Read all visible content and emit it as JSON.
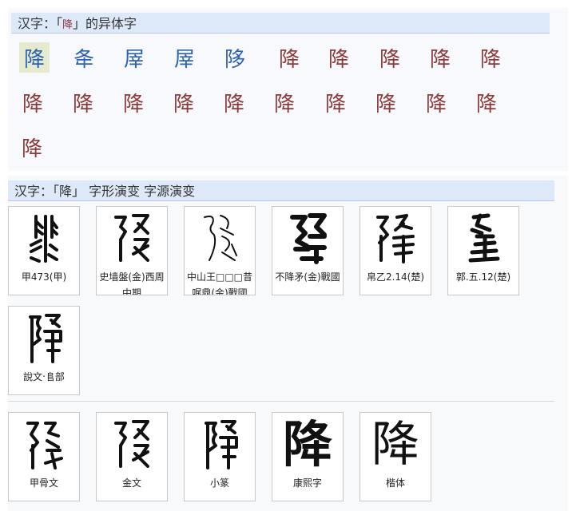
{
  "variants_header": {
    "prefix": "汉字：「",
    "char": "降",
    "suffix": "」的异体字"
  },
  "variant_glyphs": [
    {
      "text": "降",
      "style": "blue-selected"
    },
    {
      "text": "夅",
      "style": "blue"
    },
    {
      "text": "屖",
      "style": "blue"
    },
    {
      "text": "屖",
      "style": "blue"
    },
    {
      "text": "陊",
      "style": "blue"
    },
    {
      "text": "降",
      "style": "red"
    },
    {
      "text": "降",
      "style": "red"
    },
    {
      "text": "降",
      "style": "red"
    },
    {
      "text": "降",
      "style": "red"
    },
    {
      "text": "降",
      "style": "red"
    },
    {
      "text": "降",
      "style": "red"
    },
    {
      "text": "降",
      "style": "red"
    },
    {
      "text": "降",
      "style": "red"
    },
    {
      "text": "降",
      "style": "red"
    },
    {
      "text": "降",
      "style": "red"
    },
    {
      "text": "降",
      "style": "red"
    },
    {
      "text": "降",
      "style": "red"
    },
    {
      "text": "降",
      "style": "red"
    },
    {
      "text": "降",
      "style": "red"
    },
    {
      "text": "降",
      "style": "red"
    },
    {
      "text": "降",
      "style": "red"
    }
  ],
  "evolution_header": {
    "text": "汉字：「降」 字形演变 字源演变"
  },
  "ancient_forms": [
    {
      "icon": "oracle-bone-glyph-icon",
      "caption": "甲473(甲)"
    },
    {
      "icon": "bronze-glyph-icon",
      "caption": "史墙盤(金)西周中期"
    },
    {
      "icon": "bronze-glyph-icon",
      "caption": "中山王□□□昔𠳿鼎(金)戰國"
    },
    {
      "icon": "bronze-glyph-icon",
      "caption": "不降矛(金)戰國"
    },
    {
      "icon": "chu-glyph-icon",
      "caption": "帛乙2.14(楚)"
    },
    {
      "icon": "chu-glyph-icon",
      "caption": "郭.五.12(楚)"
    },
    {
      "icon": "seal-glyph-icon",
      "caption": "說文‧𨸏部"
    }
  ],
  "script_styles": [
    {
      "icon": "oracle-bone-glyph-icon",
      "caption": "甲骨文"
    },
    {
      "icon": "bronze-glyph-icon",
      "caption": "金文"
    },
    {
      "icon": "seal-glyph-icon",
      "caption": "小篆"
    },
    {
      "icon": "kangxi-glyph-icon",
      "text": "降",
      "caption": "康熙字"
    },
    {
      "icon": "kaishu-glyph-icon",
      "text": "降",
      "caption": "楷体"
    }
  ]
}
